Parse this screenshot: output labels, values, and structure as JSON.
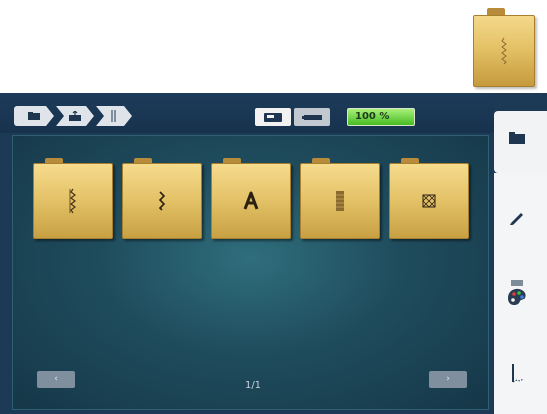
{
  "zoom_label": "100 %",
  "pager_label": "1/1",
  "nav": {
    "prev_label": "‹",
    "next_label": "›"
  },
  "tiles": [
    {
      "icon": "straight-stitch-icon"
    },
    {
      "icon": "zigzag-stitch-icon"
    },
    {
      "icon": "letter-a-icon"
    },
    {
      "icon": "satin-stitch-icon"
    },
    {
      "icon": "pattern-grid-icon"
    }
  ],
  "colors": {
    "zoom_green": "#5bd030",
    "folder_gold": "#e2bf63",
    "panel_blue": "#1c3a56"
  }
}
